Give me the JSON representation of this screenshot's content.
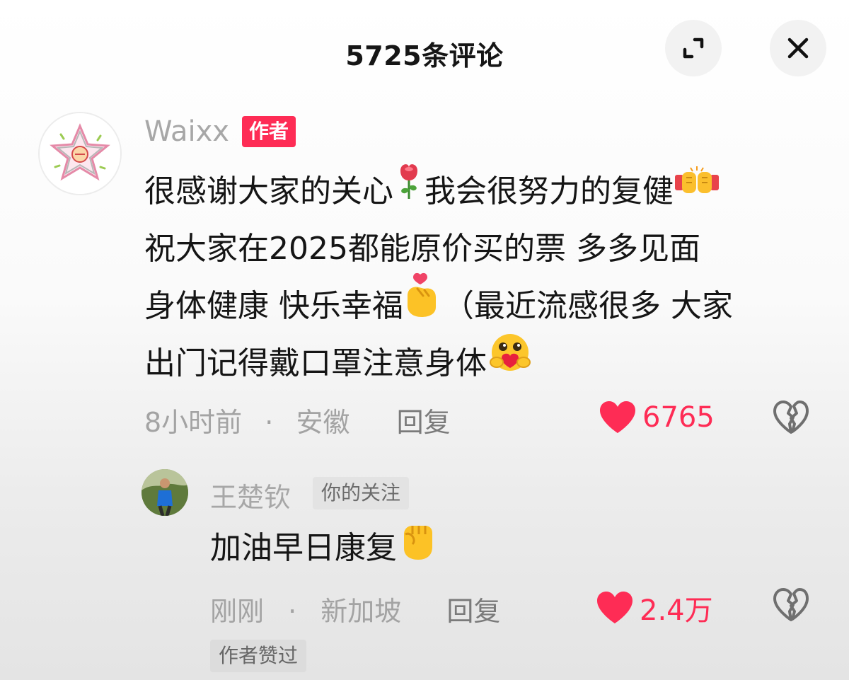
{
  "header": {
    "title": "5725条评论"
  },
  "comment": {
    "author": "Waixx",
    "author_badge": "作者",
    "lines": [
      [
        "很感谢大家的关心",
        "我会很努力的复健"
      ],
      [
        "祝大家在2025都能原价买的票 多多见面"
      ],
      [
        "身体健康 快乐幸福",
        "（最近流感很多 大家"
      ],
      [
        "出门记得戴口罩注意身体"
      ]
    ],
    "emoji_names": [
      "rose-emoji",
      "fist-bump-emoji",
      "finger-heart-emoji",
      "hugging-heart-emoji"
    ],
    "time": "8小时前",
    "separator": "·",
    "location": "安徽",
    "reply_label": "回复",
    "likes": "6765"
  },
  "reply": {
    "author": "王楚钦",
    "follow_badge": "你的关注",
    "text": "加油早日康复",
    "emoji_name": "raised-fist-emoji",
    "time": "刚刚",
    "separator": "·",
    "location": "新加坡",
    "reply_label": "回复",
    "likes": "2.4万",
    "author_liked_badge": "作者赞过"
  },
  "colors": {
    "like_red": "#fe2c55",
    "muted_gray": "#a3a3a3"
  }
}
